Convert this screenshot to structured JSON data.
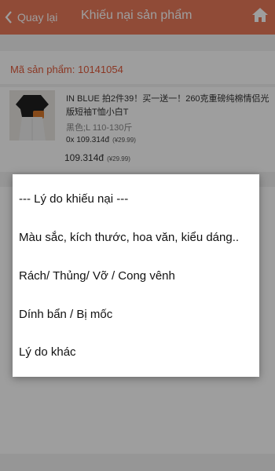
{
  "header": {
    "back_label": "Quay lại",
    "title": "Khiếu nại sản phẩm"
  },
  "product": {
    "code_line": "Mã sản phẩm: 10141054",
    "name": "IN BLUE 拍2件39！买一送一！260克重磅纯棉情侣光版短袖T恤小白T",
    "variant": "黑色;L 110-130斤",
    "qty_price": "0x 109.314đ",
    "qty_price_cny": "(¥29.99)",
    "total": "109.314đ",
    "total_cny": "(¥29.99)"
  },
  "reason_modal": {
    "options": [
      {
        "label": "--- Lý do khiếu nại ---"
      },
      {
        "label": "Màu sắc, kích thước, hoa văn, kiểu dáng.."
      },
      {
        "label": "Rách/ Thủng/ Vỡ / Cong vênh"
      },
      {
        "label": "Dính bẩn / Bị mốc"
      },
      {
        "label": "Lý do khác"
      }
    ]
  },
  "colors": {
    "header_bg": "#e8795a",
    "accent_text": "#e05a3a"
  }
}
